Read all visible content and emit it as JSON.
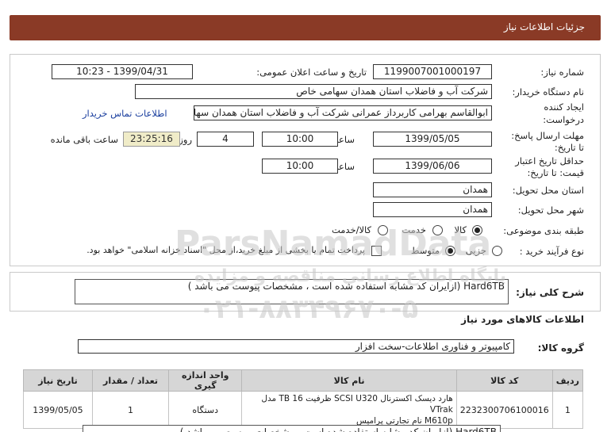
{
  "page_title": "جزئیات اطلاعات نیاز",
  "fields": {
    "need_number_label": "شماره نیاز:",
    "need_number": "1199007001000197",
    "announce_label": "تاریخ و ساعت اعلان عمومی:",
    "announce_value": "1399/04/31 - 10:23",
    "buyer_org_label": "نام دستگاه خریدار:",
    "buyer_org": "شرکت آب و فاضلاب استان همدان سهامی خاص",
    "requester_label_1": "ایجاد کننده",
    "requester_label_2": "درخواست:",
    "requester": "ابوالقاسم بهرامی کاربرداز عمرانی شرکت آب و فاضلاب استان همدان سهامی خاص",
    "contact_link": "اطلاعات تماس خریدار",
    "reply_deadline_label_1": "مهلت ارسال پاسخ:",
    "reply_deadline_label_2": "تا تاریخ:",
    "reply_date": "1399/05/05",
    "time_label": "ساعت",
    "reply_time": "10:00",
    "days_value": "4",
    "days_label": "روز و",
    "remaining_time": "23:25:16",
    "remaining_label": "ساعت باقی مانده",
    "validity_label_1": "حداقل تاریخ اعتبار",
    "validity_label_2": "قیمت: تا تاریخ:",
    "validity_date": "1399/06/06",
    "validity_time": "10:00",
    "province_label": "استان محل تحویل:",
    "province": "همدان",
    "city_label": "شهر محل تحویل:",
    "city": "همدان",
    "category_label": "طبقه بندی موضوعی:",
    "category_options": [
      "کالا",
      "خدمت",
      "کالا/خدمت"
    ],
    "process_label": "نوع فرآیند خرید :",
    "process_options": [
      "جزیی",
      "متوسط"
    ],
    "payment_note": "پرداخت تمام یا بخشی از مبلغ خرید،از محل \"اسناد خزانه اسلامی\" خواهد بود."
  },
  "description": {
    "label": "شرح کلی نیاز:",
    "text": "Hard6TB (ازایران کد مشابه استفاده شده است ، مشخصات پیوست می باشد )"
  },
  "goods": {
    "section_title": "اطلاعات کالاهای مورد نیاز",
    "group_label": "گروه کالا:",
    "group_value": "کامپیوتر و فناوری اطلاعات-سخت افزار",
    "headers": [
      "ردیف",
      "کد کالا",
      "نام کالا",
      "واحد اندازه گیری",
      "تعداد / مقدار",
      "تاریخ نیاز"
    ],
    "rows": [
      {
        "index": "1",
        "code": "2232300706100016",
        "name_line1": "هارد دیسک اکسترنال SCSI U320 ظرفیت 16 TB مدل VTrak",
        "name_line2": "M610p نام تجارتی پرامیس",
        "unit": "دستگاه",
        "qty": "1",
        "date": "1399/05/05"
      }
    ]
  },
  "bottom_desc_partial": "Hard6TB (ازایران کد مشابه استفاده شده است ، مشخصات پیوست می باشد )",
  "watermark": {
    "line1": "ParsNamadData",
    "line2": "پایگاه اطلاع رسانی مناقصه و مزایده",
    "line3": "۰۲۱-۸۸۳۴۹۶۷۰-۵"
  }
}
